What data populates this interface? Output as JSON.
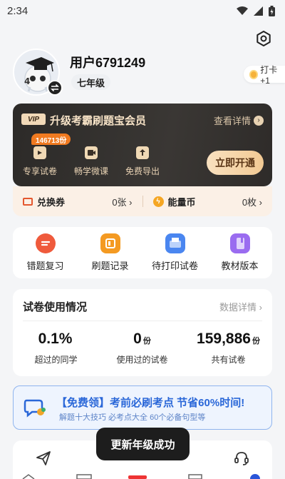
{
  "status_bar": {
    "time": "2:34"
  },
  "colors": {
    "vip_gold": "#f1d9b8",
    "vip_dark": "#2c2a28",
    "accent_orange": "#f07a20",
    "promo_blue": "#2a67d8"
  },
  "profile": {
    "username": "用户6791249",
    "grade": "七年级",
    "checkin_label": "打卡+1"
  },
  "vip": {
    "badge": "VIP",
    "title": "升级考霸刷题宝会员",
    "detail_link": "查看详情",
    "count_badge": "146713份",
    "features": [
      "专享试卷",
      "畅学微课",
      "免费导出"
    ],
    "open_button": "立即开通"
  },
  "wallet": {
    "coupon_label": "兑换券",
    "coupon_value": "0张 ›",
    "coin_label": "能量币",
    "coin_value": "0枚 ›"
  },
  "tools": [
    {
      "label": "错题复习",
      "icon": "mistake-review-icon",
      "color": "#ef5a3c"
    },
    {
      "label": "刷题记录",
      "icon": "practice-record-icon",
      "color": "#f49a22"
    },
    {
      "label": "待打印试卷",
      "icon": "print-paper-icon",
      "color": "#4a86f0"
    },
    {
      "label": "教材版本",
      "icon": "textbook-icon",
      "color": "#9a6cf0"
    }
  ],
  "stats": {
    "title": "试卷使用情况",
    "detail_link": "数据详情 ›",
    "items": [
      {
        "num": "0.1%",
        "unit": "",
        "label": "超过的同学"
      },
      {
        "num": "0",
        "unit": "份",
        "label": "使用过的试卷"
      },
      {
        "num": "159,886",
        "unit": "份",
        "label": "共有试卷"
      }
    ]
  },
  "promo": {
    "title": "【免费领】考前必刷考点 节省60%时间!",
    "subtitle": "解题十大技巧 必考点大全 60个必备句型等"
  },
  "toast": "更新年级成功"
}
